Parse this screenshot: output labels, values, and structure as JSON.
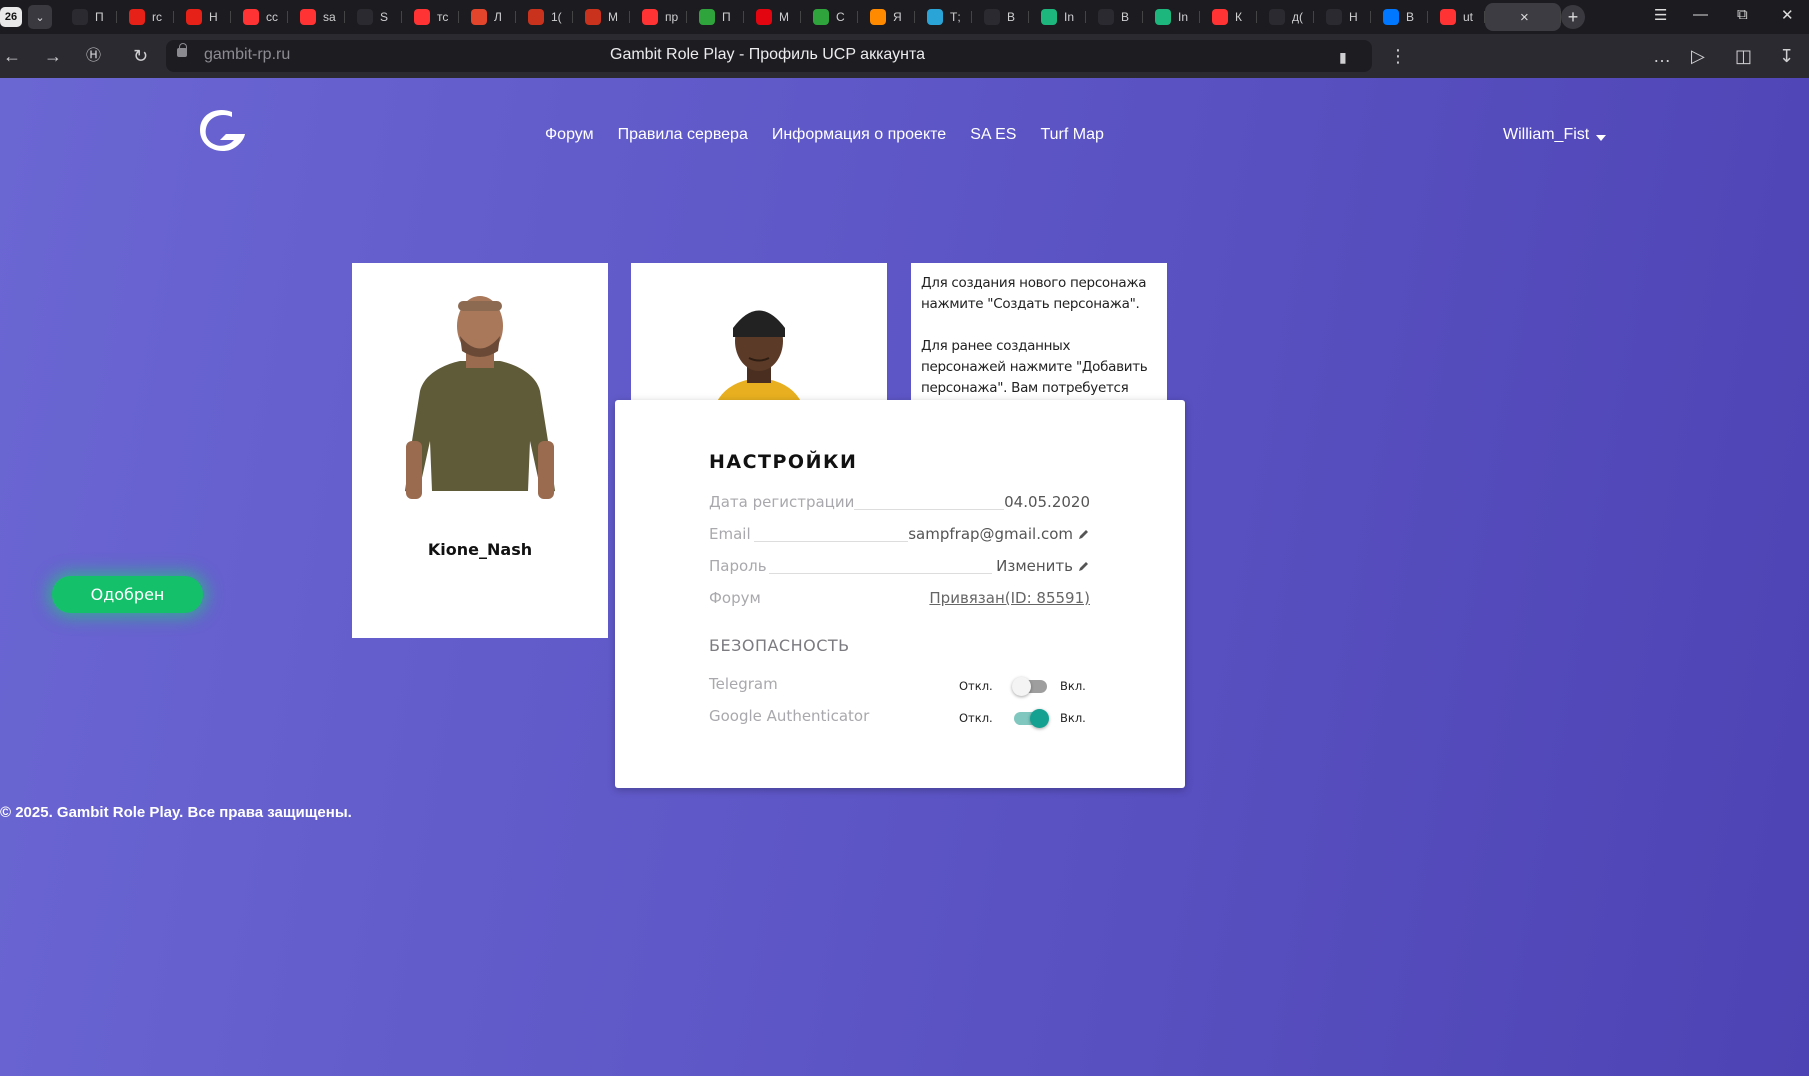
{
  "browser": {
    "tab_count": "26",
    "tabs": [
      {
        "icon": "gambit-icon",
        "title": "П",
        "color": "#2b2a30"
      },
      {
        "icon": "youtube-icon",
        "title": "rc",
        "color": "#e62117"
      },
      {
        "icon": "youtube-icon",
        "title": "Н",
        "color": "#e62117"
      },
      {
        "icon": "yandex-icon",
        "title": "cc",
        "color": "#f33"
      },
      {
        "icon": "yandex-icon",
        "title": "sa",
        "color": "#f33"
      },
      {
        "icon": "castle-icon",
        "title": "S",
        "color": "#2b2a30"
      },
      {
        "icon": "yandex-icon",
        "title": "тс",
        "color": "#f33"
      },
      {
        "icon": "co-icon",
        "title": "Л",
        "color": "#e2452b"
      },
      {
        "icon": "red-square-icon",
        "title": "1(",
        "color": "#c9321d"
      },
      {
        "icon": "red-square-icon",
        "title": "М",
        "color": "#c9321d"
      },
      {
        "icon": "yandex-icon",
        "title": "пр",
        "color": "#f33"
      },
      {
        "icon": "hd-icon",
        "title": "П",
        "color": "#2fa43d"
      },
      {
        "icon": "mts-icon",
        "title": "М",
        "color": "#e30611"
      },
      {
        "icon": "hd-icon",
        "title": "С",
        "color": "#2fa43d"
      },
      {
        "icon": "fire-icon",
        "title": "Я",
        "color": "#ff8a00"
      },
      {
        "icon": "t-icon",
        "title": "Т;",
        "color": "#2aa4d6"
      },
      {
        "icon": "castle-icon",
        "title": "В",
        "color": "#2b2a30"
      },
      {
        "icon": "green-icon",
        "title": "In",
        "color": "#1db77e"
      },
      {
        "icon": "castle-icon",
        "title": "В",
        "color": "#2b2a30"
      },
      {
        "icon": "green-icon",
        "title": "In",
        "color": "#1db77e"
      },
      {
        "icon": "yandex-icon",
        "title": "К",
        "color": "#f33"
      },
      {
        "icon": "gambit-icon",
        "title": "д(",
        "color": "#2b2a30"
      },
      {
        "icon": "gambit-icon",
        "title": "Н",
        "color": "#2b2a30"
      },
      {
        "icon": "vk-icon",
        "title": "В",
        "color": "#0077ff"
      },
      {
        "icon": "yandex-icon",
        "title": "ut",
        "color": "#f33"
      }
    ],
    "active_tab_title": "×",
    "url": "gambit-rp.ru",
    "page_title": "Gambit Role Play - Профиль UCP аккаунта"
  },
  "nav": {
    "items": [
      "Форум",
      "Правила сервера",
      "Информация о проекте",
      "SA ES",
      "Turf Map"
    ],
    "user": "William_Fist"
  },
  "characters": [
    {
      "name": "Kione_Nash",
      "status": "Одобрен"
    },
    {
      "name": ""
    }
  ],
  "info_text": [
    "Для создания нового персонажа нажмите \"Создать персонажа\".",
    "Для ранее созданных персонажей нажмите \"Добавить персонажа\". Вам потребуется имя персонажа,"
  ],
  "settings": {
    "title": "НАСТРОЙКИ",
    "rows": [
      {
        "label": "Дата регистрации",
        "value": "04.05.2020"
      },
      {
        "label": "Email",
        "value": "sampfrap@gmail.com"
      },
      {
        "label": "Пароль",
        "value": "Изменить"
      },
      {
        "label": "Форум",
        "value": "Привязан(ID: 85591)"
      }
    ],
    "security_title": "БЕЗОПАСНОСТЬ",
    "toggles": [
      {
        "label": "Telegram",
        "off": "Откл.",
        "on": "Вкл.",
        "enabled": false
      },
      {
        "label": "Google Authenticator",
        "off": "Откл.",
        "on": "Вкл.",
        "enabled": true
      }
    ]
  },
  "footer": "© 2025. Gambit Role Play. Все права защищены.",
  "colors": {
    "accent": "#15c06a",
    "toggle_on": "#14a192",
    "background_start": "#6a66d2",
    "background_end": "#4e43b4"
  }
}
